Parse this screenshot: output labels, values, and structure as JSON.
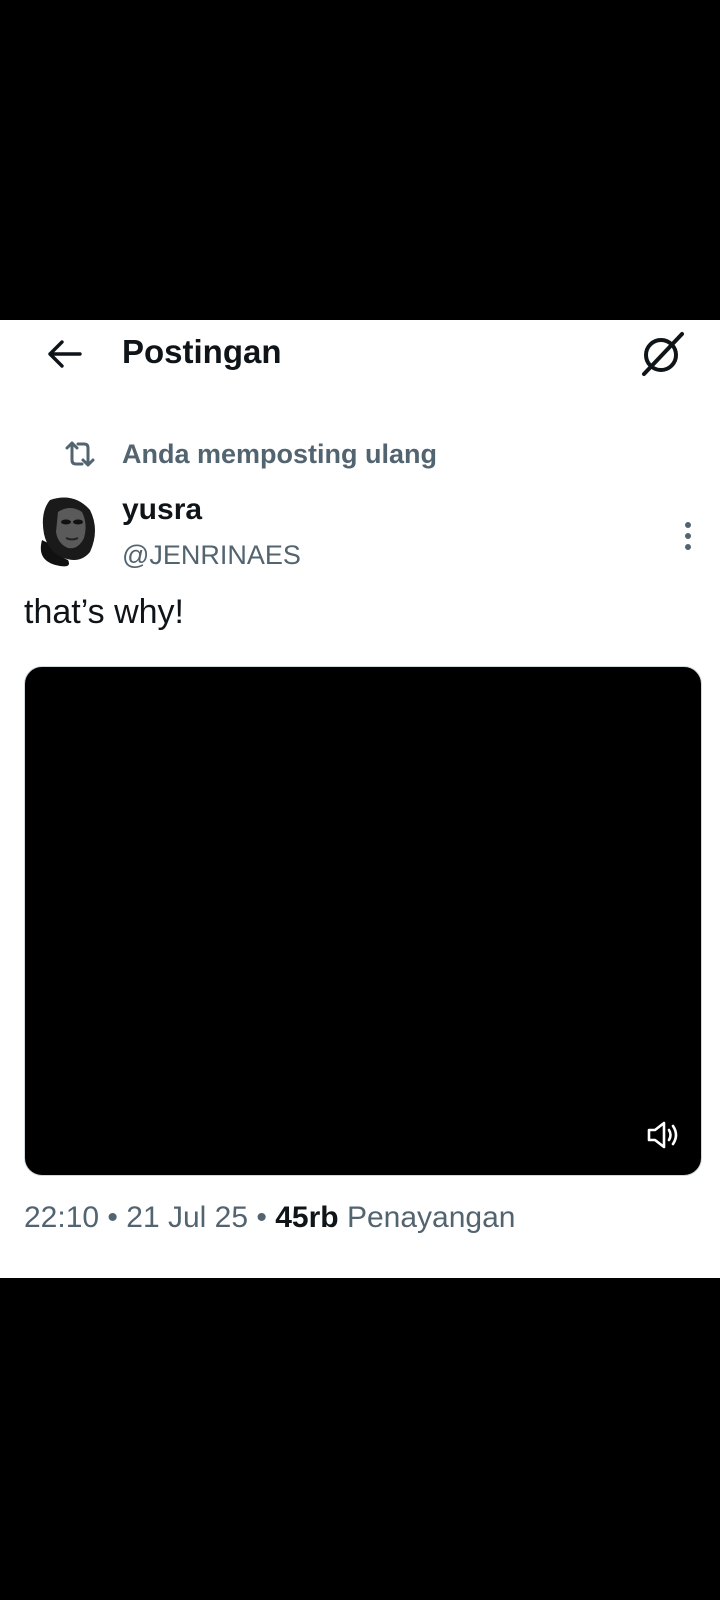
{
  "header": {
    "title": "Postingan",
    "back_icon": "arrow-left-icon",
    "grok_icon": "grok-icon"
  },
  "repost": {
    "icon": "repost-icon",
    "label": "Anda memposting ulang"
  },
  "post": {
    "display_name": "yusra",
    "handle": "@JENRINAES",
    "text": "that’s why!",
    "time": "22:10",
    "separator1": "•",
    "date": "21 Jul 25",
    "separator2": "•",
    "views_count": "45rb",
    "views_label": "Penayangan"
  },
  "video": {
    "volume_icon": "volume-icon"
  },
  "colors": {
    "text_primary": "#0f1419",
    "text_secondary": "#536471",
    "background": "#ffffff",
    "frame": "#000000"
  }
}
